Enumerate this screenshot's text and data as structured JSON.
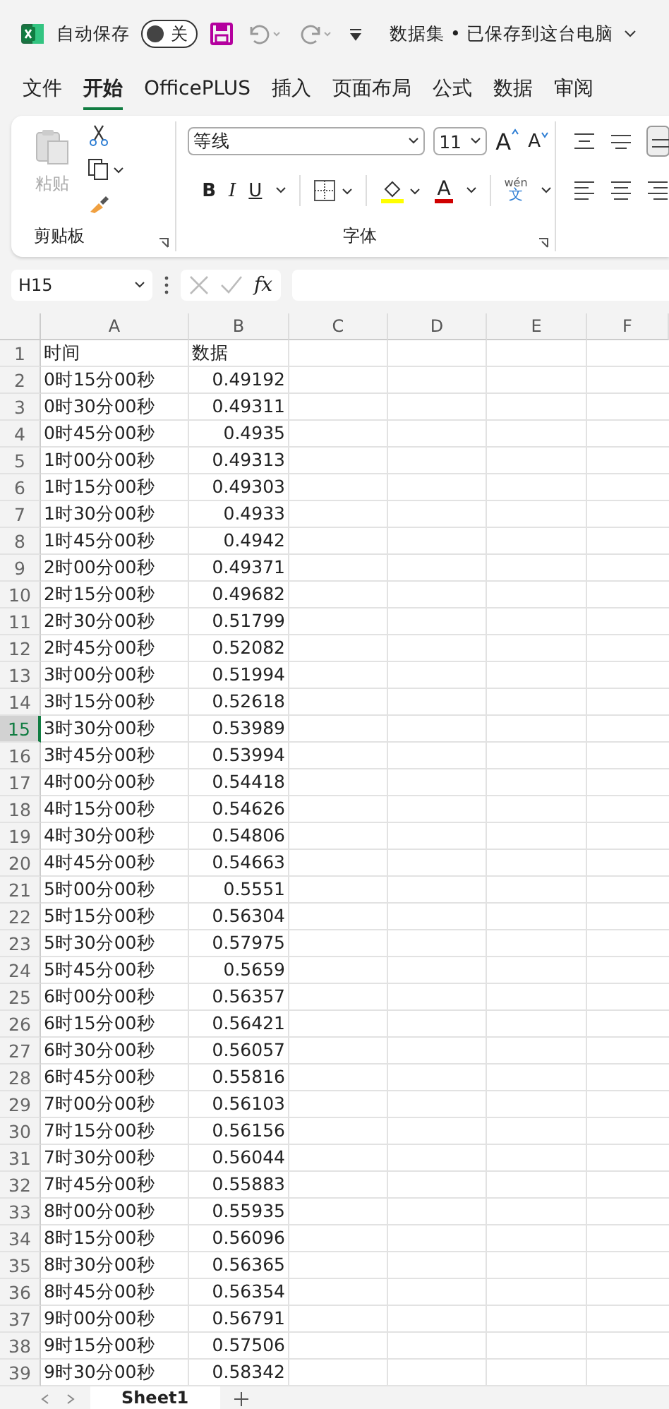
{
  "title_bar": {
    "autosave_label": "自动保存",
    "autosave_toggle": {
      "on": false,
      "label": "关"
    },
    "document_title": "数据集 • 已保存到这台电脑"
  },
  "tabs": [
    {
      "label": "文件",
      "selected": false
    },
    {
      "label": "开始",
      "selected": true
    },
    {
      "label": "OfficePLUS",
      "selected": false
    },
    {
      "label": "插入",
      "selected": false
    },
    {
      "label": "页面布局",
      "selected": false
    },
    {
      "label": "公式",
      "selected": false
    },
    {
      "label": "数据",
      "selected": false
    },
    {
      "label": "审阅",
      "selected": false
    }
  ],
  "ribbon": {
    "clipboard": {
      "paste_label": "粘贴",
      "paste_disabled": true,
      "group_label": "剪贴板"
    },
    "font": {
      "font_name": "等线",
      "font_size": "11",
      "grow_label": "A",
      "shrink_label": "A",
      "bold_label": "B",
      "italic_label": "I",
      "underline_label": "U",
      "font_color_label": "A",
      "phonetic_top": "wén",
      "phonetic_bottom": "文",
      "group_label": "字体"
    }
  },
  "formula_bar": {
    "name_box": "H15",
    "fx_label": "fx"
  },
  "sheet": {
    "columns": [
      "A",
      "B",
      "C",
      "D",
      "E",
      "F"
    ],
    "rows": [
      {
        "number": "1",
        "a": "时间",
        "b": "数据",
        "selected": false
      },
      {
        "number": "2",
        "a": "0时15分00秒",
        "b": "0.49192",
        "selected": false
      },
      {
        "number": "3",
        "a": "0时30分00秒",
        "b": "0.49311",
        "selected": false
      },
      {
        "number": "4",
        "a": "0时45分00秒",
        "b": "0.4935",
        "selected": false
      },
      {
        "number": "5",
        "a": "1时00分00秒",
        "b": "0.49313",
        "selected": false
      },
      {
        "number": "6",
        "a": "1时15分00秒",
        "b": "0.49303",
        "selected": false
      },
      {
        "number": "7",
        "a": "1时30分00秒",
        "b": "0.4933",
        "selected": false
      },
      {
        "number": "8",
        "a": "1时45分00秒",
        "b": "0.4942",
        "selected": false
      },
      {
        "number": "9",
        "a": "2时00分00秒",
        "b": "0.49371",
        "selected": false
      },
      {
        "number": "10",
        "a": "2时15分00秒",
        "b": "0.49682",
        "selected": false
      },
      {
        "number": "11",
        "a": "2时30分00秒",
        "b": "0.51799",
        "selected": false
      },
      {
        "number": "12",
        "a": "2时45分00秒",
        "b": "0.52082",
        "selected": false
      },
      {
        "number": "13",
        "a": "3时00分00秒",
        "b": "0.51994",
        "selected": false
      },
      {
        "number": "14",
        "a": "3时15分00秒",
        "b": "0.52618",
        "selected": false
      },
      {
        "number": "15",
        "a": "3时30分00秒",
        "b": "0.53989",
        "selected": true
      },
      {
        "number": "16",
        "a": "3时45分00秒",
        "b": "0.53994",
        "selected": false
      },
      {
        "number": "17",
        "a": "4时00分00秒",
        "b": "0.54418",
        "selected": false
      },
      {
        "number": "18",
        "a": "4时15分00秒",
        "b": "0.54626",
        "selected": false
      },
      {
        "number": "19",
        "a": "4时30分00秒",
        "b": "0.54806",
        "selected": false
      },
      {
        "number": "20",
        "a": "4时45分00秒",
        "b": "0.54663",
        "selected": false
      },
      {
        "number": "21",
        "a": "5时00分00秒",
        "b": "0.5551",
        "selected": false
      },
      {
        "number": "22",
        "a": "5时15分00秒",
        "b": "0.56304",
        "selected": false
      },
      {
        "number": "23",
        "a": "5时30分00秒",
        "b": "0.57975",
        "selected": false
      },
      {
        "number": "24",
        "a": "5时45分00秒",
        "b": "0.5659",
        "selected": false
      },
      {
        "number": "25",
        "a": "6时00分00秒",
        "b": "0.56357",
        "selected": false
      },
      {
        "number": "26",
        "a": "6时15分00秒",
        "b": "0.56421",
        "selected": false
      },
      {
        "number": "27",
        "a": "6时30分00秒",
        "b": "0.56057",
        "selected": false
      },
      {
        "number": "28",
        "a": "6时45分00秒",
        "b": "0.55816",
        "selected": false
      },
      {
        "number": "29",
        "a": "7时00分00秒",
        "b": "0.56103",
        "selected": false
      },
      {
        "number": "30",
        "a": "7时15分00秒",
        "b": "0.56156",
        "selected": false
      },
      {
        "number": "31",
        "a": "7时30分00秒",
        "b": "0.56044",
        "selected": false
      },
      {
        "number": "32",
        "a": "7时45分00秒",
        "b": "0.55883",
        "selected": false
      },
      {
        "number": "33",
        "a": "8时00分00秒",
        "b": "0.55935",
        "selected": false
      },
      {
        "number": "34",
        "a": "8时15分00秒",
        "b": "0.56096",
        "selected": false
      },
      {
        "number": "35",
        "a": "8时30分00秒",
        "b": "0.56365",
        "selected": false
      },
      {
        "number": "36",
        "a": "8时45分00秒",
        "b": "0.56354",
        "selected": false
      },
      {
        "number": "37",
        "a": "9时00分00秒",
        "b": "0.56791",
        "selected": false
      },
      {
        "number": "38",
        "a": "9时15分00秒",
        "b": "0.57506",
        "selected": false
      },
      {
        "number": "39",
        "a": "9时30分00秒",
        "b": "0.58342",
        "selected": false
      }
    ]
  },
  "sheet_tabs": [
    {
      "label": "Sheet1",
      "selected": true
    }
  ]
}
